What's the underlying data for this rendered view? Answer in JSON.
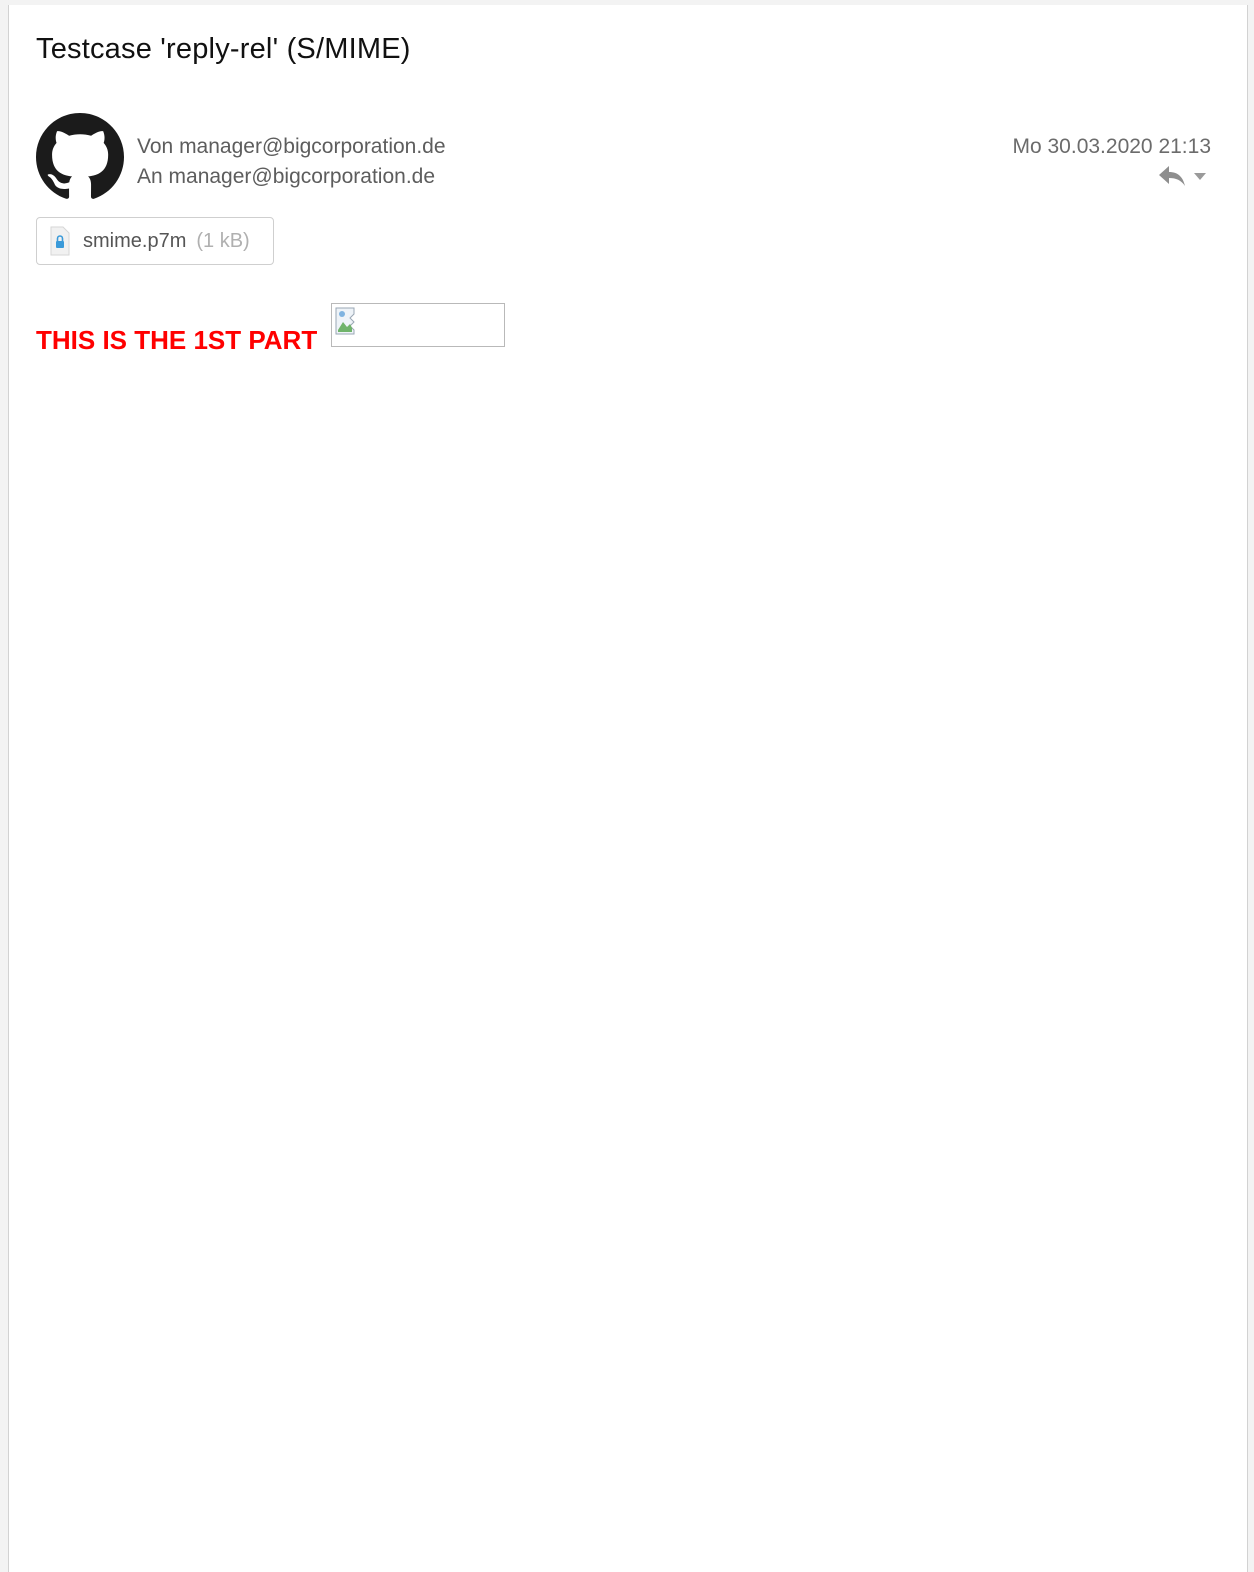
{
  "message": {
    "subject": "Testcase 'reply-rel' (S/MIME)",
    "from_label": "Von",
    "from_address": "manager@bigcorporation.de",
    "to_label": "An",
    "to_address": "manager@bigcorporation.de",
    "date": "Mo 30.03.2020 21:13",
    "avatar_icon": "github-octocat-icon"
  },
  "actions": {
    "reply_icon": "reply-icon",
    "more_icon": "chevron-down-icon"
  },
  "attachment": {
    "name": "smime.p7m",
    "size": "(1 kB)",
    "icon": "encrypted-file-icon"
  },
  "body": {
    "text": "THIS IS THE 1ST PART",
    "image_icon": "broken-image-icon"
  },
  "colors": {
    "body_text": "#ff0000",
    "meta_text": "#5d5d5d",
    "attachment_icon": "#3a9ad9"
  }
}
